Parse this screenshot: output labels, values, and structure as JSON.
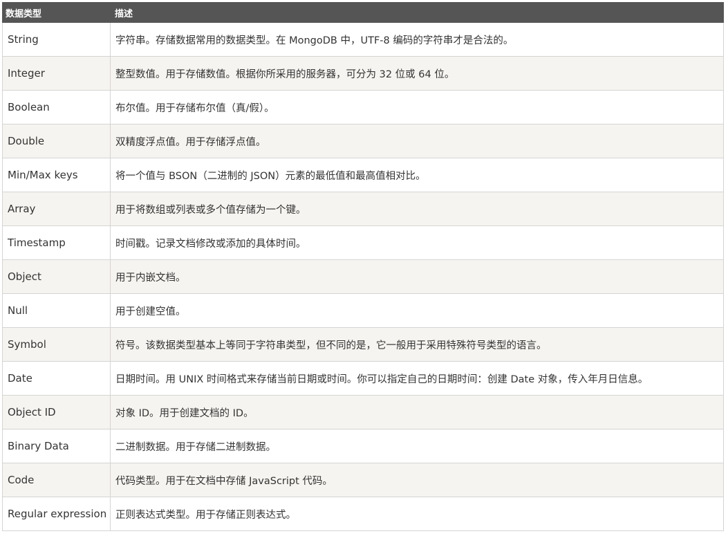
{
  "header": {
    "col_type": "数据类型",
    "col_desc": "描述"
  },
  "rows": [
    {
      "type": "String",
      "desc": "字符串。存储数据常用的数据类型。在 MongoDB 中，UTF-8 编码的字符串才是合法的。"
    },
    {
      "type": "Integer",
      "desc": "整型数值。用于存储数值。根据你所采用的服务器，可分为 32 位或 64 位。"
    },
    {
      "type": "Boolean",
      "desc": "布尔值。用于存储布尔值（真/假）。"
    },
    {
      "type": "Double",
      "desc": "双精度浮点值。用于存储浮点值。"
    },
    {
      "type": "Min/Max keys",
      "desc": "将一个值与 BSON（二进制的 JSON）元素的最低值和最高值相对比。"
    },
    {
      "type": "Array",
      "desc": "用于将数组或列表或多个值存储为一个键。"
    },
    {
      "type": "Timestamp",
      "desc": "时间戳。记录文档修改或添加的具体时间。"
    },
    {
      "type": "Object",
      "desc": "用于内嵌文档。"
    },
    {
      "type": "Null",
      "desc": "用于创建空值。"
    },
    {
      "type": "Symbol",
      "desc": "符号。该数据类型基本上等同于字符串类型，但不同的是，它一般用于采用特殊符号类型的语言。"
    },
    {
      "type": "Date",
      "desc": "日期时间。用 UNIX 时间格式来存储当前日期或时间。你可以指定自己的日期时间：创建 Date 对象，传入年月日信息。"
    },
    {
      "type": "Object ID",
      "desc": "对象 ID。用于创建文档的 ID。"
    },
    {
      "type": "Binary Data",
      "desc": "二进制数据。用于存储二进制数据。"
    },
    {
      "type": "Code",
      "desc": "代码类型。用于在文档中存储 JavaScript 代码。"
    },
    {
      "type": "Regular expression",
      "desc": "正则表达式类型。用于存储正则表达式。"
    }
  ]
}
